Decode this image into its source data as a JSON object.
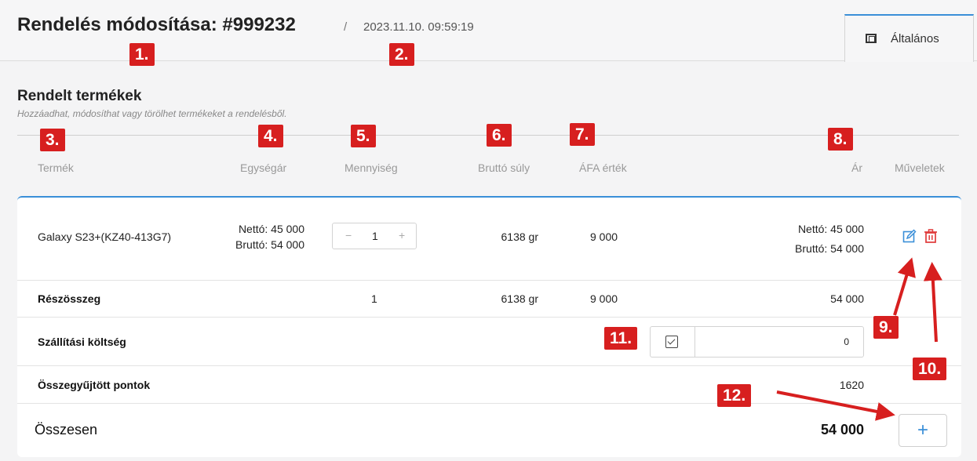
{
  "header": {
    "title": "Rendelés módosítása: #999232",
    "separator": "/",
    "datetime": "2023.11.10. 09:59:19",
    "tab_label": "Általános"
  },
  "section": {
    "title": "Rendelt termékek",
    "subtitle": "Hozzáadhat, módosíthat vagy törölhet termékeket a rendelésből."
  },
  "columns": {
    "product": "Termék",
    "unit_price": "Egységár",
    "quantity": "Mennyiség",
    "gross_weight": "Bruttó súly",
    "vat": "ÁFA érték",
    "price": "Ár",
    "actions": "Műveletek"
  },
  "item": {
    "name": "Galaxy S23+(KZ40-413G7)",
    "unit_net": "Nettó: 45 000",
    "unit_gross": "Bruttó: 54 000",
    "qty_minus": "−",
    "qty": "1",
    "qty_plus": "+",
    "weight": "6138 gr",
    "vat": "9 000",
    "price_net": "Nettó: 45 000",
    "price_gross": "Bruttó: 54 000"
  },
  "subtotal": {
    "label": "Részösszeg",
    "qty": "1",
    "weight": "6138 gr",
    "vat": "9 000",
    "amount": "54 000"
  },
  "shipping": {
    "label": "Szállítási költség",
    "value": "0"
  },
  "points": {
    "label": "Összegyűjtött pontok",
    "value": "1620"
  },
  "total": {
    "label": "Összesen",
    "amount": "54 000",
    "add_symbol": "+"
  },
  "annotations": [
    "1.",
    "2.",
    "3.",
    "4.",
    "5.",
    "6.",
    "7.",
    "8.",
    "9.",
    "10.",
    "11.",
    "12."
  ],
  "colors": {
    "accent": "#3a8fd8",
    "annotation_red": "#d71f1f",
    "delete_red": "#e03a3a"
  },
  "icons": {
    "tab": "fullscreen-icon",
    "edit": "edit-icon",
    "delete": "trash-icon",
    "shipping_toggle": "checkbox-icon",
    "add": "plus-icon"
  }
}
